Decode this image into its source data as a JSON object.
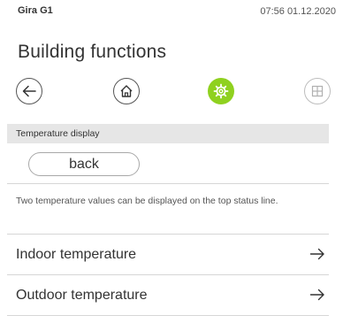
{
  "status_bar": {
    "device_name": "Gira G1",
    "time_date": "07:56 01.12.2020"
  },
  "page": {
    "title": "Building functions"
  },
  "nav": {
    "items": [
      {
        "icon": "arrow-left-icon",
        "state": "default"
      },
      {
        "icon": "home-icon",
        "state": "default"
      },
      {
        "icon": "gear-icon",
        "state": "active",
        "color": "#8fd11f"
      },
      {
        "icon": "grid-icon",
        "state": "disabled"
      }
    ]
  },
  "section": {
    "title": "Temperature display"
  },
  "back_button": {
    "label": "back"
  },
  "description": "Two temperature values can be displayed on the top status line.",
  "list": {
    "items": [
      {
        "label": "Indoor temperature",
        "icon": "arrow-right-icon"
      },
      {
        "label": "Outdoor temperature",
        "icon": "arrow-right-icon"
      }
    ]
  },
  "colors": {
    "accent": "#8fd11f",
    "section_background": "#e6e6e6",
    "divider": "#d6d6d6"
  }
}
